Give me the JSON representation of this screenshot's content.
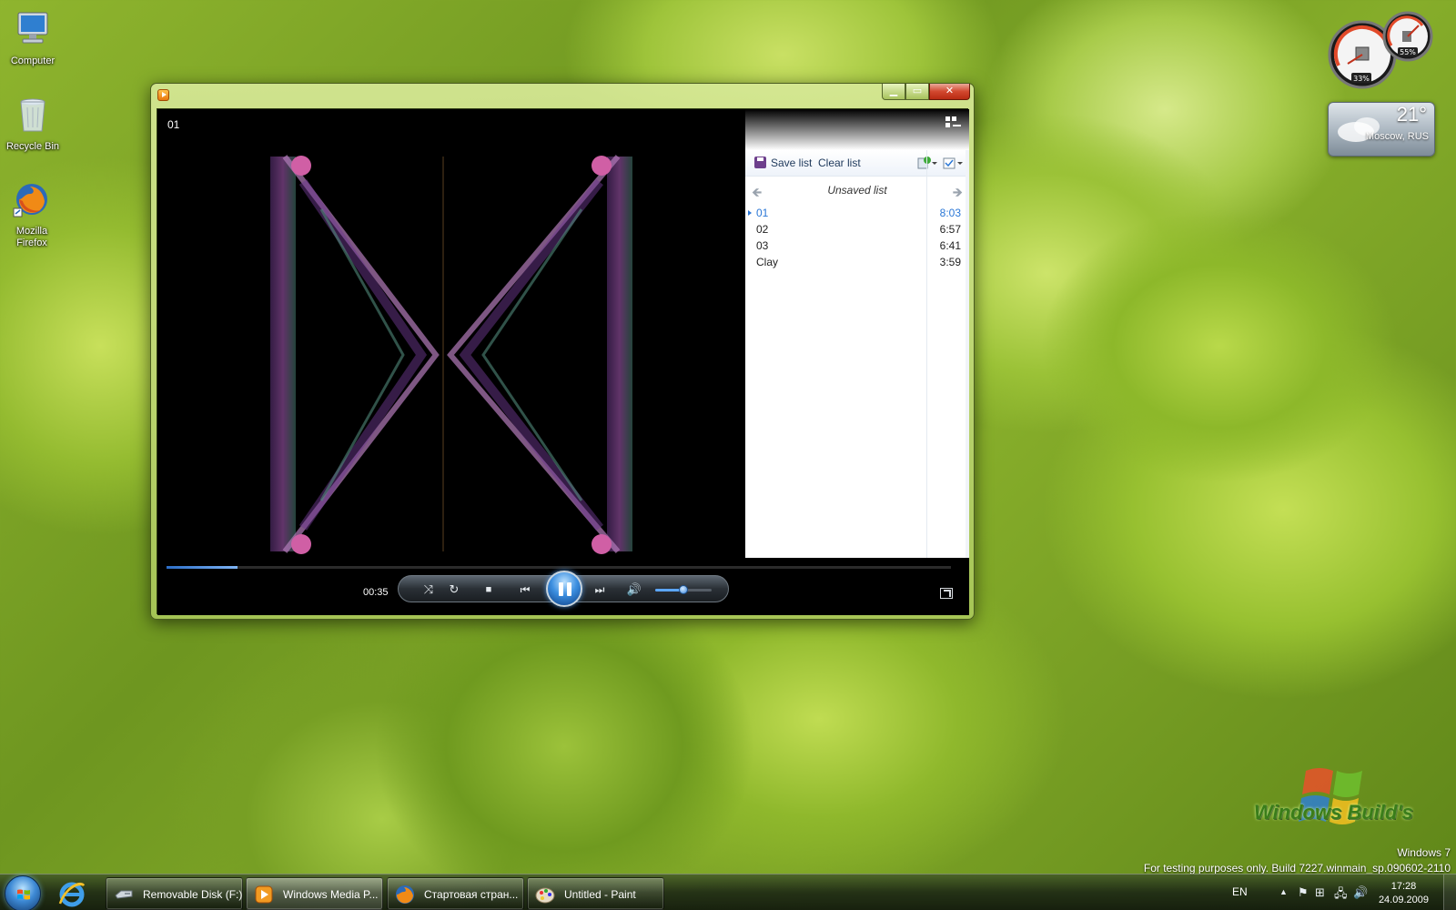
{
  "desktop": {
    "icons": [
      {
        "label": "Computer"
      },
      {
        "label": "Recycle Bin"
      },
      {
        "label": "Mozilla Firefox"
      }
    ]
  },
  "gadgets": {
    "cpu_meter": {
      "cpu": "33%",
      "memory": "55%"
    },
    "weather": {
      "temperature": "21°",
      "location": "Moscow, RUS"
    }
  },
  "wmp": {
    "now_playing_title": "01",
    "playlist": {
      "save_label": "Save list",
      "clear_label": "Clear list",
      "list_name": "Unsaved list",
      "tracks": [
        {
          "name": "01",
          "duration": "8:03",
          "active": true
        },
        {
          "name": "02",
          "duration": "6:57",
          "active": false
        },
        {
          "name": "03",
          "duration": "6:41",
          "active": false
        },
        {
          "name": "Clay",
          "duration": "3:59",
          "active": false
        }
      ]
    },
    "controls": {
      "elapsed": "00:35",
      "seek_progress": 0.09,
      "volume": 0.5,
      "state": "playing"
    }
  },
  "watermark": {
    "logo_text": "Windows Build's",
    "os_name": "Windows 7",
    "build_line": "For testing purposes only. Build 7227.winmain_sp.090602-2110"
  },
  "taskbar": {
    "buttons": [
      {
        "label": "Removable Disk (F:)",
        "icon": "drive-icon",
        "active": false
      },
      {
        "label": "Windows Media P...",
        "icon": "wmp-icon",
        "active": true
      },
      {
        "label": "Стартовая стран...",
        "icon": "firefox-icon",
        "active": false
      },
      {
        "label": "Untitled - Paint",
        "icon": "paint-icon",
        "active": false
      }
    ],
    "tray": {
      "language": "EN",
      "time": "17:28",
      "date": "24.09.2009"
    }
  },
  "colors": {
    "accent": "#2a77d6",
    "window_frame": "#b8d36a",
    "taskbar": "#1c2a14"
  }
}
